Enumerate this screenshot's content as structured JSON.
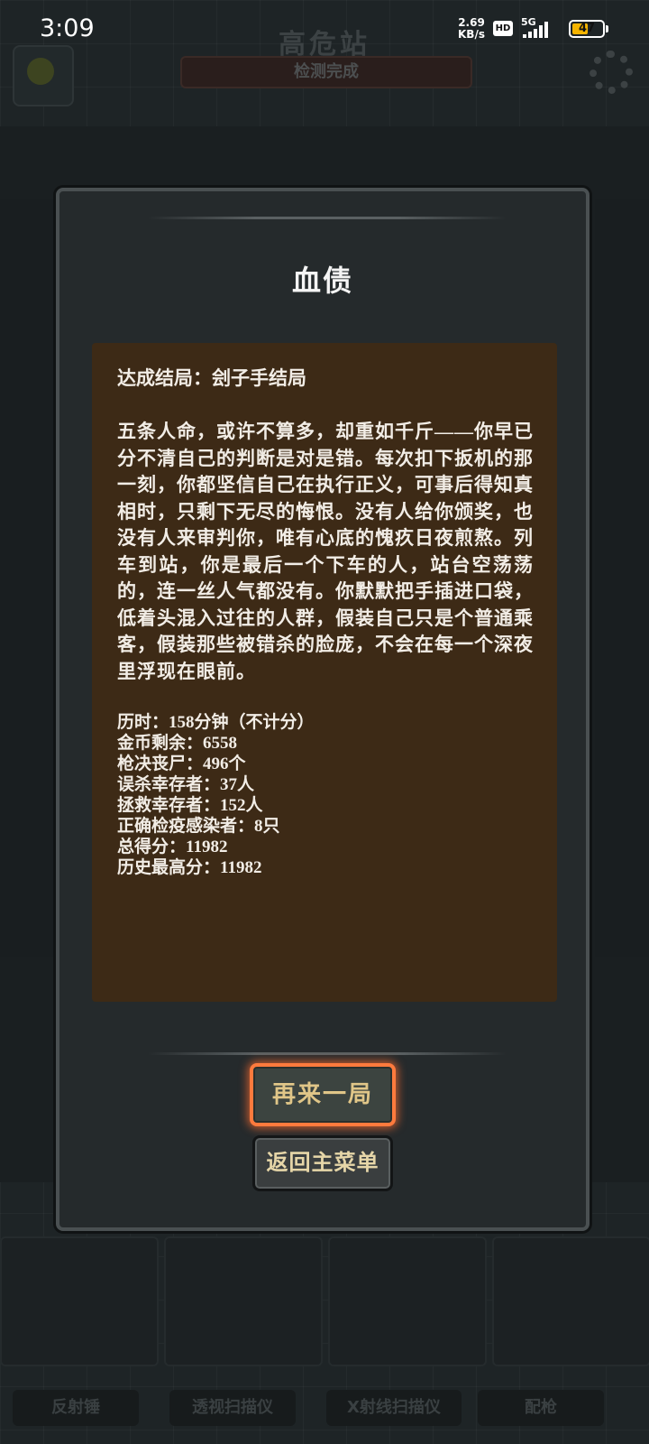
{
  "status_bar": {
    "time": "3:09",
    "speed_value": "2.69",
    "speed_unit": "KB/s",
    "hd": "HD",
    "network": "5G",
    "battery": "47"
  },
  "background": {
    "title": "高危站",
    "subtitle": "检测完成",
    "tools": [
      "反射锤",
      "透视扫描仪",
      "X射线扫描仪",
      "配枪"
    ]
  },
  "dialog": {
    "title": "血债",
    "ending": "达成结局：刽子手结局",
    "story": "五条人命，或许不算多，却重如千斤——你早已分不清自己的判断是对是错。每次扣下扳机的那一刻，你都坚信自己在执行正义，可事后得知真相时，只剩下无尽的悔恨。没有人给你颁奖，也没有人来审判你，唯有心底的愧疚日夜煎熬。列车到站，你是最后一个下车的人，站台空荡荡的，连一丝人气都没有。你默默把手插进口袋，低着头混入过往的人群，假装自己只是个普通乘客，假装那些被错杀的脸庞，不会在每一个深夜里浮现在眼前。",
    "stats": [
      "历时：158分钟（不计分）",
      "金币剩余：6558",
      "枪决丧尸：496个",
      "误杀幸存者：37人",
      "拯救幸存者：152人",
      "正确检疫感染者：8只",
      "总得分：11982",
      "历史最高分：11982"
    ],
    "restart_label": "再来一局",
    "menu_label": "返回主菜单"
  },
  "colors": {
    "dialog_bg": "#252a2c",
    "result_box_bg": "#3d2a16",
    "restart_glow": "#ff7a3d",
    "button_text": "#e0c688"
  }
}
